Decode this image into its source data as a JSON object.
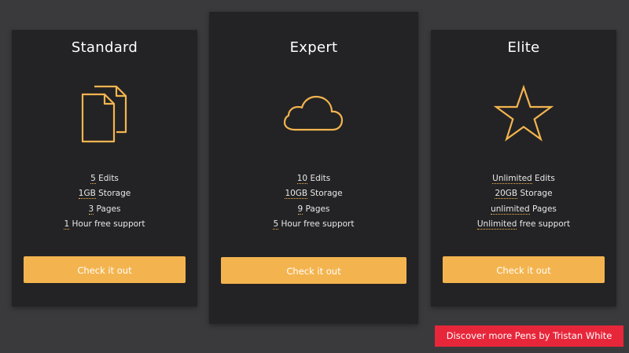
{
  "colors": {
    "background": "#3a3a3d",
    "card": "#232325",
    "accent": "#f3b44f",
    "discover": "#e8263a"
  },
  "plans": [
    {
      "title": "Standard",
      "icon": "documents-icon",
      "features": [
        {
          "num": "5",
          "text": " Edits"
        },
        {
          "num": "1GB",
          "text": " Storage"
        },
        {
          "num": "3",
          "text": " Pages"
        },
        {
          "num": "1",
          "text": " Hour free support"
        }
      ],
      "cta": "Check it out"
    },
    {
      "title": "Expert",
      "icon": "cloud-icon",
      "features": [
        {
          "num": "10",
          "text": " Edits"
        },
        {
          "num": "10GB",
          "text": " Storage"
        },
        {
          "num": "9",
          "text": " Pages"
        },
        {
          "num": "5",
          "text": " Hour free support"
        }
      ],
      "cta": "Check it out"
    },
    {
      "title": "Elite",
      "icon": "star-icon",
      "features": [
        {
          "num": "Unlimited",
          "text": " Edits"
        },
        {
          "num": "20GB",
          "text": " Storage"
        },
        {
          "num": "unlimited",
          "text": " Pages"
        },
        {
          "num": "Unlimited",
          "text": " free support"
        }
      ],
      "cta": "Check it out"
    }
  ],
  "footer": {
    "discover_label": "Discover more Pens by Tristan White"
  }
}
